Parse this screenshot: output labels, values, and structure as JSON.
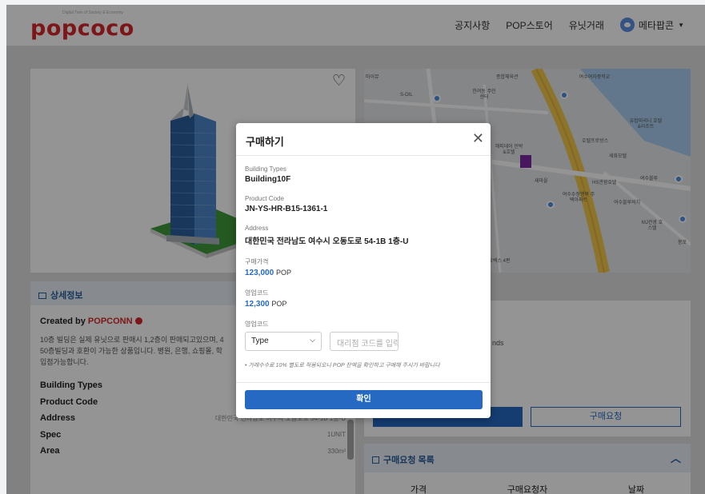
{
  "header": {
    "logo": "popcoco",
    "logo_sub": "Digital Twin of Society & Economy",
    "nav": [
      "공지사항",
      "POP스토어",
      "유닛거래"
    ],
    "user": "메타팝콘",
    "caret": "▼"
  },
  "detail": {
    "heading": "상세정보",
    "created_prefix": "Created by",
    "creator": "POPCONN",
    "description": "10층 빌딩은 실제 유닛으로 판매시 1,2층이 판매되고있으며, 4\n50층빌딩과 호환이 가능한 상품입니다. 병원, 은행, 쇼핑몰, 학\n입점가능합니다.",
    "specs": [
      {
        "key": "Building Types",
        "value": ""
      },
      {
        "key": "Product Code",
        "value": ""
      },
      {
        "key": "Address",
        "value": "대한민국 전라남도 여수시 오동도로 54-1B 1층-U"
      },
      {
        "key": "Spec",
        "value": "1UNIT"
      },
      {
        "key": "Area",
        "value": "330m²"
      }
    ]
  },
  "right": {
    "partial_text": "nds",
    "purchase_request_button": "구매요청",
    "request_list_title": "구매요청 목록",
    "columns": [
      "가격",
      "구매요청자",
      "날짜"
    ]
  },
  "map": {
    "labels": [
      "마이뮤",
      "종합체육관",
      "여수여자중학교",
      "S-OIL",
      "한려동\n주민센터",
      "해피데이\n민박&호텔",
      "유탑마리나\n호텔&리조트",
      "호텔프로방스",
      "세화모텔",
      "새마을",
      "HS관광호텔",
      "여수블루",
      "여수수정행복\n주택아파트",
      "여수블루비치",
      "MJ관광\n호스텔",
      "봉포",
      "오렉스\n4편"
    ]
  },
  "modal": {
    "title": "구매하기",
    "close": "✕",
    "fields": {
      "building_types_label": "Building Types",
      "building_types_value": "Building10F",
      "product_code_label": "Product Code",
      "product_code_value": "JN-YS-HR-B15-1361-1",
      "address_label": "Address",
      "address_value": "대한민국 전라남도 여수시 오동도로 54-1B 1층-U",
      "price_label": "구매가격",
      "price_value": "123,000",
      "price_unit": "POP",
      "sales_code_label": "영업코드",
      "sales_value": "12,300",
      "sales_unit": "POP",
      "code_label": "영업코드",
      "type_select": "Type",
      "agency_placeholder": "대리점 코드를 입력하세요",
      "note": "• 거래수수료 10% 별도로 적용되오니 POP 잔액을 확인하고 구매해 주시기 바랍니다"
    },
    "confirm": "확인"
  },
  "colors": {
    "brand": "#d8262c",
    "primary": "#2569c3"
  }
}
